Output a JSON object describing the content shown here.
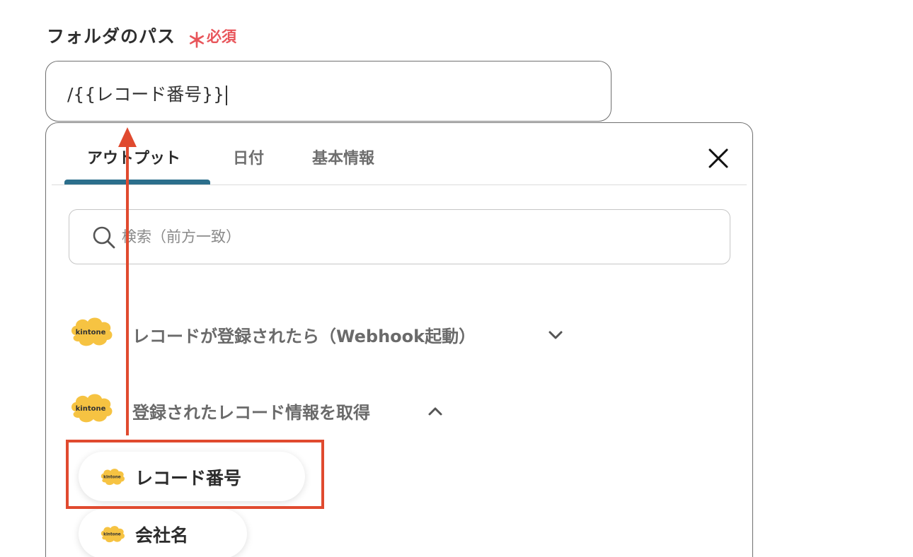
{
  "field": {
    "label": "フォルダのパス",
    "required_mark": "＊",
    "required_text": "必須",
    "value": "/{{レコード番号}}"
  },
  "panel": {
    "tabs": [
      {
        "label": "アウトプット",
        "active": true
      },
      {
        "label": "日付",
        "active": false
      },
      {
        "label": "基本情報",
        "active": false
      }
    ],
    "search_placeholder": "検索（前方一致）",
    "groups": [
      {
        "title": "レコードが登録されたら（Webhook起動）",
        "expanded": false,
        "logo_text": "kintone"
      },
      {
        "title": "登録されたレコード情報を取得",
        "expanded": true,
        "logo_text": "kintone"
      }
    ],
    "items": [
      {
        "label": "レコード番号",
        "logo_text": "kintone",
        "highlighted": true
      },
      {
        "label": "会社名",
        "logo_text": "kintone",
        "highlighted": false
      }
    ]
  },
  "colors": {
    "accent_tab": "#2c6f8c",
    "required": "#e8555a",
    "annotation": "#e04a2f",
    "kintone_yellow": "#f6c342"
  }
}
